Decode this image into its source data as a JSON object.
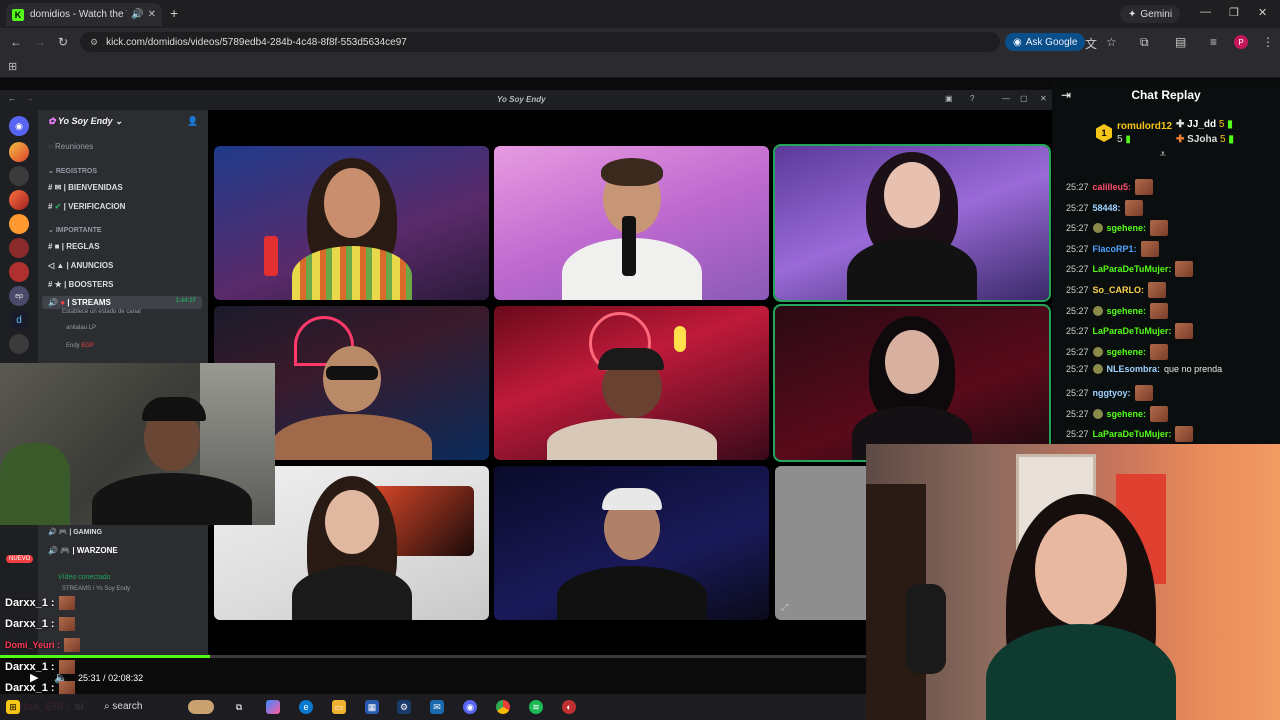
{
  "browser": {
    "tab_title": "domidios - Watch the VOD",
    "tab_favicon": "kick-logo-icon",
    "new_tab": "+",
    "gemini_label": "Gemini",
    "url": "kick.com/domidios/videos/5789edb4-284b-4c48-8f8f-553d5634ce97",
    "ask_google": "Ask Google",
    "profile_initial": "P"
  },
  "discord": {
    "window_title": "Yo Soy Endy",
    "server_name": "Yo Soy Endy",
    "channels": [
      {
        "label": "Reuniones",
        "kind": "plain"
      },
      {
        "label": "REGISTROS",
        "kind": "category"
      },
      {
        "label": "| BIENVENIDAS",
        "kind": "text"
      },
      {
        "label": "| VERIFICACION",
        "kind": "text"
      },
      {
        "label": "IMPORTANTE",
        "kind": "category"
      },
      {
        "label": "| REGLAS",
        "kind": "text"
      },
      {
        "label": "| ANUNCIOS",
        "kind": "text"
      },
      {
        "label": "| BOOSTERS",
        "kind": "text"
      },
      {
        "label": "| STREAMS",
        "kind": "voice-active"
      }
    ],
    "streams_time": "1:44:37",
    "streams_status": "Establece un estado de canal",
    "voice_members": [
      {
        "name": "anitalau",
        "tag": "LP"
      },
      {
        "name": "Endy",
        "tag": "EGP"
      }
    ],
    "lower_channels": [
      {
        "label": "| GAMING"
      },
      {
        "label": "| WARZONE"
      }
    ],
    "new_badge": "NUEVO",
    "voice_connected": "Vídeo conectado",
    "voice_location": "STREAMS / Yo Soy Endy"
  },
  "chat": {
    "header": "Chat Replay",
    "top_gifters": [
      {
        "name": "romulord12",
        "count": "5",
        "rank": "1"
      },
      {
        "name": "JJ_dd",
        "count": "5"
      },
      {
        "name": "SJoha",
        "count": "5"
      }
    ],
    "messages": [
      {
        "ts": "25:27",
        "user": "calilleu5:",
        "color": "#ff4d6d",
        "text": "",
        "emote": true
      },
      {
        "ts": "25:27",
        "user": "58448:",
        "color": "#9fd3ff",
        "text": "",
        "emote": true
      },
      {
        "ts": "25:27",
        "user": "sgehene:",
        "color": "#53fc18",
        "text": "",
        "emote": true,
        "badge": true
      },
      {
        "ts": "25:27",
        "user": "FlacoRP1:",
        "color": "#4fa3ff",
        "text": "",
        "emote": true
      },
      {
        "ts": "25:27",
        "user": "LaParaDeTuMujer:",
        "color": "#53fc18",
        "text": "",
        "emote": true
      },
      {
        "ts": "25:27",
        "user": "So_CARLO:",
        "color": "#ffd24d",
        "text": "",
        "emote": true
      },
      {
        "ts": "25:27",
        "user": "sgehene:",
        "color": "#53fc18",
        "text": "",
        "emote": true,
        "badge": true
      },
      {
        "ts": "25:27",
        "user": "LaParaDeTuMujer:",
        "color": "#53fc18",
        "text": "",
        "emote": true
      },
      {
        "ts": "25:27",
        "user": "sgehene:",
        "color": "#53fc18",
        "text": "",
        "emote": true,
        "badge": true
      },
      {
        "ts": "25:27",
        "user": "NLEsombra:",
        "color": "#9fd3ff",
        "text": "que no prenda",
        "emote": false,
        "badge": true
      },
      {
        "ts": "25:27",
        "user": "nggtyoy:",
        "color": "#9fd3ff",
        "text": "",
        "emote": true
      },
      {
        "ts": "25:27",
        "user": "sgehene:",
        "color": "#53fc18",
        "text": "",
        "emote": true,
        "badge": true
      },
      {
        "ts": "25:27",
        "user": "LaParaDeTuMujer:",
        "color": "#53fc18",
        "text": "",
        "emote": true
      }
    ]
  },
  "overlay_chat": [
    {
      "user": "Darxx_1 :"
    },
    {
      "user": "Darxx_1 :"
    },
    {
      "user": "Domi_Yeuri :"
    },
    {
      "user": "Darxx_1 :"
    },
    {
      "user": "Darxx_1 :"
    },
    {
      "user": "Carlos_ERI :",
      "text": "si"
    }
  ],
  "player": {
    "current_time": "25:31",
    "separator": "/",
    "duration": "02:08:32",
    "progress": 0.242
  },
  "taskbar": {
    "search": "search"
  },
  "colors": {
    "kick_green": "#53fc18",
    "discord_speaking": "#23a55a"
  }
}
